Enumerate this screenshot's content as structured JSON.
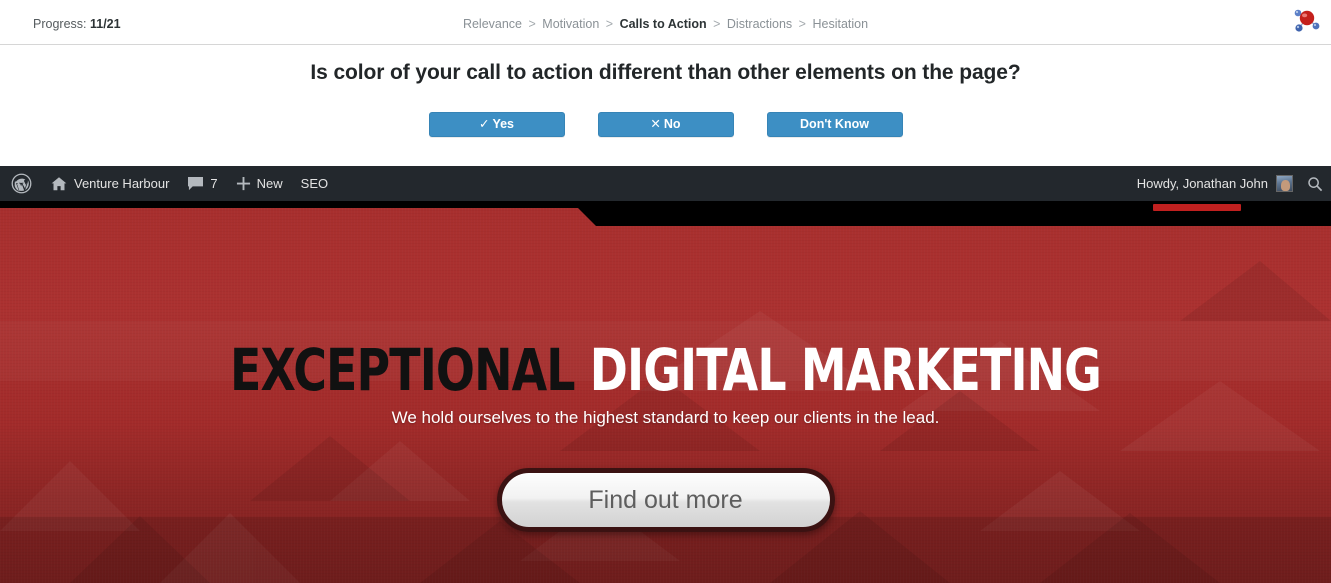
{
  "survey": {
    "progress_prefix": "Progress:",
    "progress_value": "11/21",
    "breadcrumb": [
      {
        "label": "Relevance",
        "active": false
      },
      {
        "label": "Motivation",
        "active": false
      },
      {
        "label": "Calls to Action",
        "active": true
      },
      {
        "label": "Distractions",
        "active": false
      },
      {
        "label": "Hesitation",
        "active": false
      }
    ],
    "breadcrumb_separator": ">",
    "header_icon": "molecule-icon",
    "question": "Is color of your call to action different than other elements on the page?",
    "answers": [
      {
        "glyph": "✓",
        "label": "Yes"
      },
      {
        "glyph": "✕",
        "label": "No"
      },
      {
        "glyph": "",
        "label": "Don't Know"
      }
    ],
    "button_color": "#3d8fc4"
  },
  "adminbar": {
    "background": "#23282d",
    "logo_icon": "wordpress-logo-icon",
    "home_icon": "home-icon",
    "site_name": "Venture Harbour",
    "comments_icon": "comment-bubble-icon",
    "comments_count": "7",
    "new_icon": "plus-icon",
    "new_label": "New",
    "seo_label": "SEO",
    "howdy": "Howdy, Jonathan John",
    "avatar_icon": "user-avatar",
    "search_icon": "search-icon"
  },
  "banner": {
    "background_color": "#a82f2e",
    "nav_strip_color": "#000000",
    "nav_indicator_color": "#c0201f",
    "headline_dark": "EXCEPTIONAL",
    "headline_light": "DIGITAL MARKETING",
    "subheadline": "We hold ourselves to the highest standard to keep our clients in the lead.",
    "cta_label": "Find out more"
  }
}
